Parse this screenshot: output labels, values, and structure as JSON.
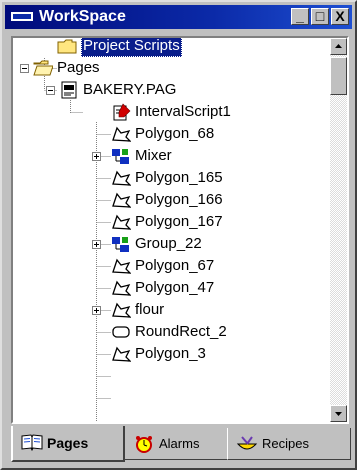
{
  "window": {
    "title": "WorkSpace",
    "buttons": {
      "minimize": "_",
      "maximize": "□",
      "close": "X"
    }
  },
  "tree": {
    "items": [
      {
        "label": "Project Scripts",
        "icon": "folder-icon",
        "selected": true
      },
      {
        "label": "Pages",
        "icon": "open-folder-icon",
        "expander": "minus"
      },
      {
        "label": "BAKERY.PAG",
        "icon": "page-document-icon",
        "expander": "minus"
      },
      {
        "label": "IntervalScript1",
        "icon": "script-icon"
      },
      {
        "label": "Polygon_68",
        "icon": "polygon-icon"
      },
      {
        "label": "Mixer",
        "icon": "group-icon",
        "expander": "plus"
      },
      {
        "label": "Polygon_165",
        "icon": "polygon-icon"
      },
      {
        "label": "Polygon_166",
        "icon": "polygon-icon"
      },
      {
        "label": "Polygon_167",
        "icon": "polygon-icon"
      },
      {
        "label": "Group_22",
        "icon": "group-icon",
        "expander": "plus"
      },
      {
        "label": "Polygon_67",
        "icon": "polygon-icon"
      },
      {
        "label": "Polygon_47",
        "icon": "polygon-icon"
      },
      {
        "label": "flour",
        "icon": "polygon-icon",
        "expander": "plus"
      },
      {
        "label": "RoundRect_2",
        "icon": "round-rect-icon"
      },
      {
        "label": "Polygon_3",
        "icon": "polygon-icon"
      }
    ]
  },
  "tabs": [
    {
      "label": "Pages",
      "icon": "book-icon",
      "active": true
    },
    {
      "label": "Alarms",
      "icon": "alarm-clock-icon",
      "active": false
    },
    {
      "label": "Recipes",
      "icon": "recipe-bowl-icon",
      "active": false
    }
  ],
  "colors": {
    "title_bar": "#0b2aa8",
    "selection": "#0a1e8c",
    "face": "#c0c0c0"
  }
}
